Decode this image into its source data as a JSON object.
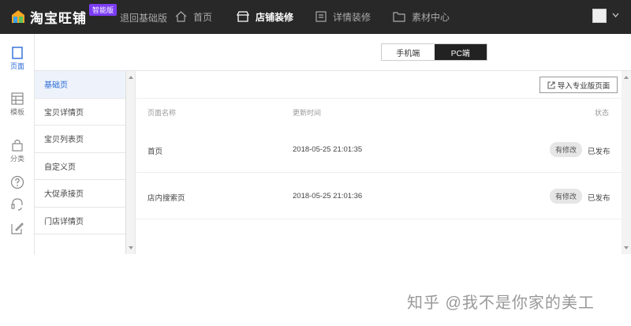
{
  "header": {
    "logo_text": "淘宝旺铺",
    "logo_badge": "智能版",
    "back_link": "退回基础版",
    "nav": [
      {
        "label": "首页",
        "icon": "home-icon"
      },
      {
        "label": "店铺装修",
        "icon": "store-icon",
        "active": true
      },
      {
        "label": "详情装修",
        "icon": "detail-icon"
      },
      {
        "label": "素材中心",
        "icon": "folder-icon"
      }
    ]
  },
  "rail": {
    "items": [
      {
        "label": "页面",
        "icon": "page-icon",
        "active": true
      },
      {
        "label": "模板",
        "icon": "template-icon"
      },
      {
        "label": "分类",
        "icon": "category-icon"
      }
    ],
    "extra_icons": [
      "help-icon",
      "support-icon",
      "edit-icon"
    ]
  },
  "device_toggle": {
    "mobile": "手机端",
    "pc": "PC端",
    "selected": "pc"
  },
  "subnav": {
    "items": [
      "基础页",
      "宝贝详情页",
      "宝贝列表页",
      "自定义页",
      "大促承接页",
      "门店详情页"
    ],
    "selected": 0
  },
  "toolbar": {
    "import_button": "导入专业版页面"
  },
  "table": {
    "headers": {
      "name": "页面名称",
      "time": "更新时间",
      "status": "状态"
    },
    "rows": [
      {
        "name": "首页",
        "time": "2018-05-25 21:01:35",
        "tag": "有修改",
        "status": "已发布"
      },
      {
        "name": "店内搜索页",
        "time": "2018-05-25 21:01:36",
        "tag": "有修改",
        "status": "已发布"
      }
    ]
  },
  "watermark": "知乎 @我不是你家的美工"
}
